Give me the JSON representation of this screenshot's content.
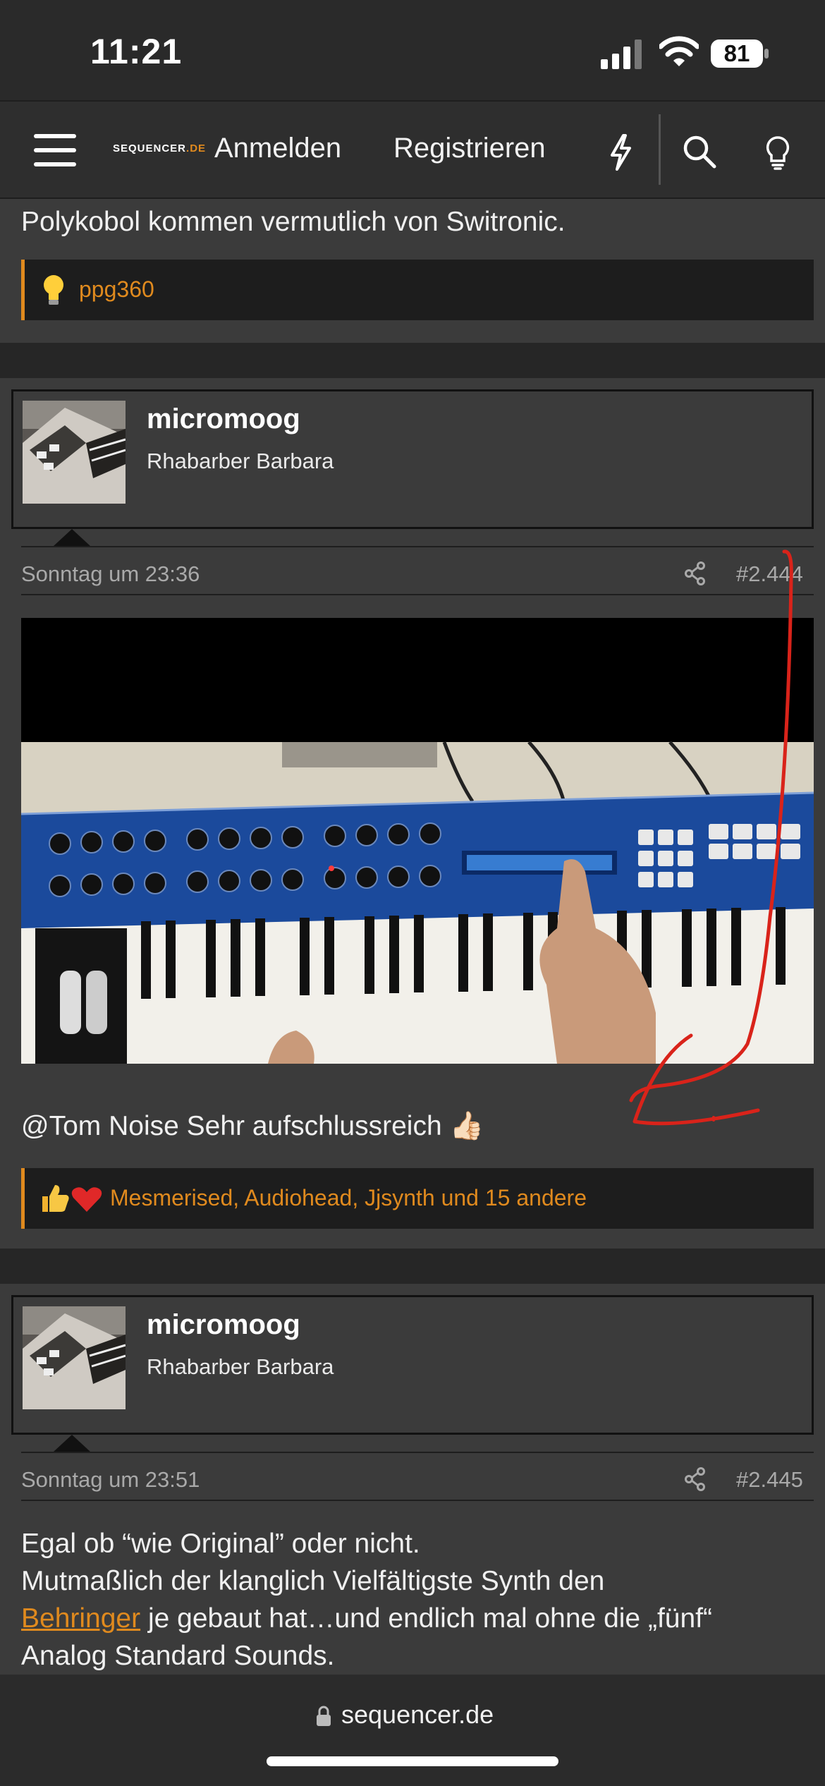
{
  "status_bar": {
    "time": "11:21",
    "battery": "81",
    "icons": [
      "signal-icon",
      "wifi-icon",
      "battery-icon"
    ]
  },
  "nav": {
    "logo": "SEQUENCER",
    "logo_tld": ".DE",
    "login": "Anmelden",
    "register": "Registrieren",
    "icons": [
      "menu-icon",
      "bolt-icon",
      "search-icon",
      "lightbulb-icon"
    ]
  },
  "previous_post": {
    "text": "Polykobol kommen vermutlich von Switronic.",
    "reaction_user": "ppg360"
  },
  "posts": [
    {
      "username": "micromoog",
      "user_title": "Rhabarber Barbara",
      "date": "Sonntag um 23:36",
      "number": "#2.444",
      "body": "@Tom Noise Sehr aufschlussreich 👍🏻",
      "reactions": "Mesmerised, Audiohead, Jjsynth und 15 andere"
    },
    {
      "username": "micromoog",
      "user_title": "Rhabarber Barbara",
      "date": "Sonntag um 23:51",
      "number": "#2.445",
      "body_line1": "Egal ob “wie Original” oder nicht.",
      "body_line2": "Mutmaßlich der klanglich Vielfältigste Synth den",
      "body_link": "Behringer",
      "body_line3_rest": " je gebaut hat…und endlich mal ohne die „fünf“",
      "body_line4": "Analog Standard Sounds."
    }
  ],
  "browser": {
    "url": "sequencer.de"
  },
  "colors": {
    "accent": "#e08a1e",
    "background": "#3b3b3b",
    "annotation": "#d9231a"
  }
}
